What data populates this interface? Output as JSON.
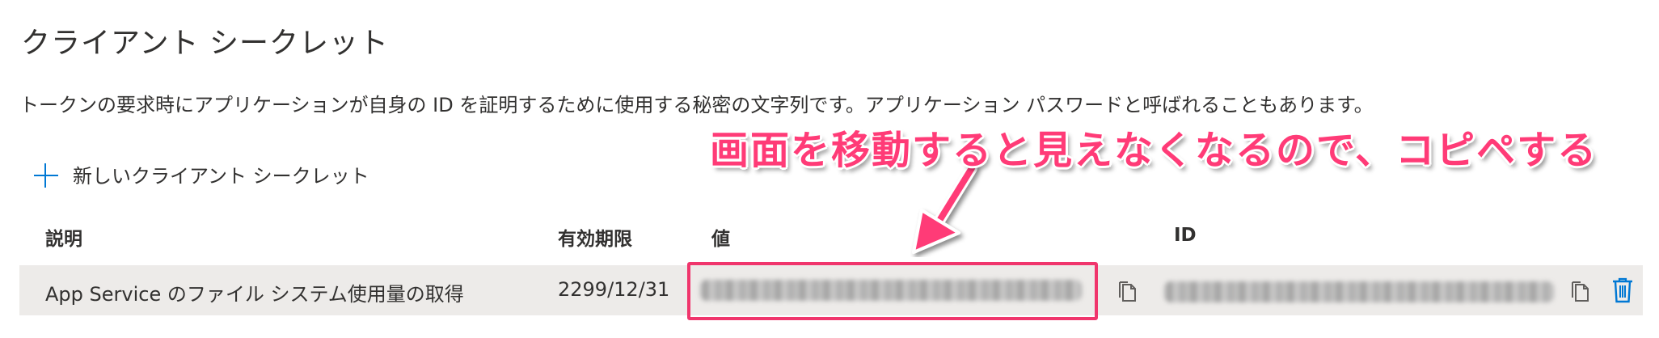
{
  "header": {
    "title": "クライアント シークレット",
    "description": "トークンの要求時にアプリケーションが自身の ID を証明するために使用する秘密の文字列です。アプリケーション パスワードと呼ばれることもあります。"
  },
  "actions": {
    "new_secret_label": "新しいクライアント シークレット",
    "new_secret_icon": "plus-icon"
  },
  "table": {
    "columns": [
      "説明",
      "有効期限",
      "値",
      "ID"
    ],
    "rows": [
      {
        "description": "App Service のファイル システム使用量の取得",
        "expires": "2299/12/31",
        "value": "",
        "id": ""
      }
    ]
  },
  "annotation": {
    "text": "画面を移動すると見えなくなるので、コピペする",
    "color": "#ff3b77"
  },
  "colors": {
    "accent": "#0078d4",
    "row_background": "#edebe9",
    "highlight_border": "#f0356c"
  }
}
